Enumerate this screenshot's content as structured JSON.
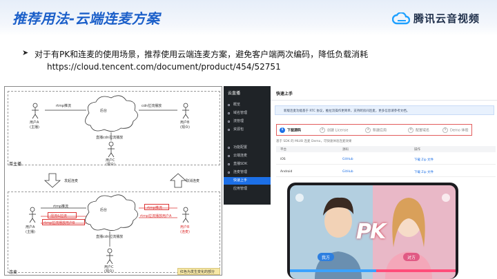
{
  "header": {
    "title": "推荐用法-云端连麦方案",
    "brand": "腾讯云音视频"
  },
  "bullet": {
    "text": "对于有PK和连麦的使用场景，推荐使用云端连麦方案，避免客户端两次编码，降低负载消耗",
    "url": "https://cloud.tencent.com/document/product/454/52751"
  },
  "diagram": {
    "top": {
      "cloud_label": "后台",
      "push_label": "rtmp推流",
      "pull_label": "cdn拉流播放",
      "cdn_label": "直播cdn拉流播放",
      "user_a": "用户A",
      "user_a_role": "(主播)",
      "user_b": "用户B",
      "user_b_role": "(观众)",
      "user_c": "用户C",
      "user_c_role": "(观众)",
      "section_label": "单主播"
    },
    "transition": {
      "start_mic": "发起连麦",
      "cancel_mic": "取消连麦"
    },
    "bottom": {
      "cloud_label": "后台",
      "push_a": "rtmp推流",
      "mix_a": "混流&拉流",
      "pull_b_a": "rtmp拉流播放用户B",
      "push_b": "rtmp推流",
      "pull_b": "rtmp拉流播放用户A",
      "cdn_label": "直播cdn拉流播放",
      "user_a": "用户A",
      "user_a_role": "(主播)",
      "user_b": "用户B",
      "user_b_role": "(连麦)",
      "user_c": "用户C",
      "user_c_role": "(观众)",
      "section_label": "连麦",
      "note": "红色为发生变化的部分"
    }
  },
  "console": {
    "logo": "云直播",
    "menu": [
      {
        "label": "概览"
      },
      {
        "label": "域名管理"
      },
      {
        "label": "流管理"
      },
      {
        "label": "资源包"
      },
      {
        "label": "功能配置"
      },
      {
        "label": "云端连麦"
      },
      {
        "label": "直播SDK"
      },
      {
        "label": "连麦管理"
      },
      {
        "label": "快速上手"
      },
      {
        "label": "应用管理"
      }
    ],
    "title": "快速上手",
    "info": "新版连麦功能基于 RTC 协议，推拉流操作更简单，支持跨房间连麦，更多信息请参考文档。",
    "steps": [
      {
        "num": "1",
        "label": "下载源码"
      },
      {
        "num": "2",
        "label": "创建 License"
      },
      {
        "num": "3",
        "label": "新建应用"
      },
      {
        "num": "4",
        "label": "配置域名"
      },
      {
        "num": "5",
        "label": "Demo 体验"
      }
    ],
    "sub": "基于 SDK 的 MLVB 连麦 Demo，可快速体验连麦效果",
    "table_headers": [
      "平台",
      "源码",
      "操作"
    ],
    "rows": [
      {
        "platform": "iOS",
        "source": "GitHub",
        "action": "下载 Zip 文件"
      },
      {
        "platform": "Android",
        "source": "GitHub",
        "action": "下载 Zip 文件"
      }
    ]
  },
  "phone": {
    "pk_text": "PK",
    "left_name": "我方",
    "right_name": "对方"
  }
}
